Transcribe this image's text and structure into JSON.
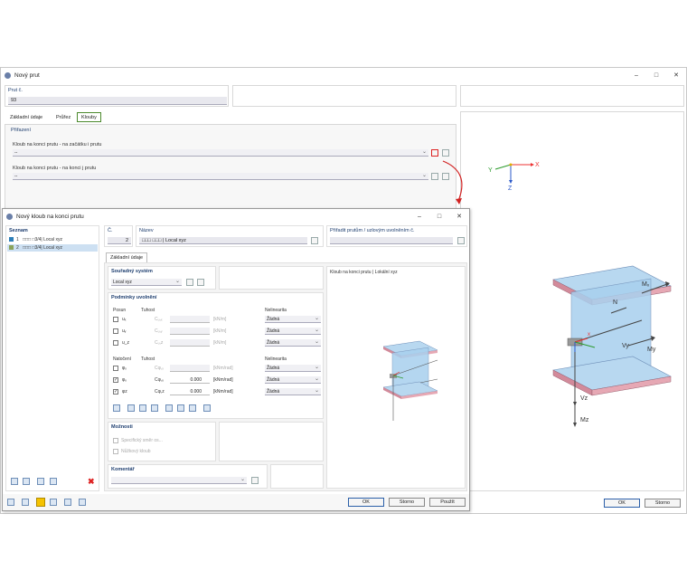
{
  "outer": {
    "title": "Nový prut",
    "prut_c_label": "Prut č.",
    "prut_c_value": "93",
    "tabs": [
      "Základní údaje",
      "Průřez",
      "Klouby"
    ],
    "prirazeni_label": "Přiřazení",
    "kloub_zacatek_label": "Kloub na konci prutu - na začátku i prutu",
    "kloub_zacatek_value": "--",
    "kloub_konec_label": "Kloub na konci prutu - na konci j prutu",
    "kloub_konec_value": "--",
    "ok": "OK",
    "storno": "Storno",
    "axis_x": "X",
    "axis_y": "Y",
    "axis_z": "Z",
    "fig": {
      "mx": "Mₓ",
      "n": "N",
      "vy": "Vy",
      "my": "My",
      "vz": "Vz",
      "mz": "Mz",
      "x": "x"
    }
  },
  "inner": {
    "title": "Nový kloub na konci prutu",
    "seznam_label": "Seznam",
    "list": [
      {
        "num": "1",
        "text": "□□□ □3/4| Local xyz",
        "color": "#2e7fb8"
      },
      {
        "num": "2",
        "text": "□□□ □3/4| Local xyz",
        "color": "#8aa35a"
      }
    ],
    "c_label": "Č.",
    "c_value": "2",
    "nazev_label": "Název",
    "nazev_value": "□□□ □□□ | Local xyz",
    "assign_label": "Přiřadit prutům / uzlovým uvolněním č.",
    "tab": "Základní údaje",
    "souradny_label": "Souřadný systém",
    "souradny_value": "Local xyz",
    "podminky_label": "Podmínky uvolnění",
    "posun_label": "Posun",
    "tuhost_label": "Tuhost",
    "nelinearita_label": "Nelinearita",
    "natoceni_label": "Natočení",
    "rows_posun": [
      {
        "sym": "uₓ",
        "c": "Cᵤ,ₓ",
        "val": "",
        "unit": "[kN/m]",
        "nl": "Žádná",
        "checked": false
      },
      {
        "sym": "uᵧ",
        "c": "Cᵤ,ᵧ",
        "val": "",
        "unit": "[kN/m]",
        "nl": "Žádná",
        "checked": false
      },
      {
        "sym": "u_z",
        "c": "Cᵤ,z",
        "val": "",
        "unit": "[kN/m]",
        "nl": "Žádná",
        "checked": false
      }
    ],
    "rows_natoceni": [
      {
        "sym": "φₓ",
        "c": "Cφ,ₓ",
        "val": "",
        "unit": "[kNm/rad]",
        "nl": "Žádná",
        "checked": false
      },
      {
        "sym": "φᵧ",
        "c": "Cφ,ᵧ",
        "val": "0.000",
        "unit": "[kNm/rad]",
        "nl": "Žádná",
        "checked": true
      },
      {
        "sym": "φz",
        "c": "Cφ,z",
        "val": "0.000",
        "unit": "[kNm/rad]",
        "nl": "Žádná",
        "checked": true
      }
    ],
    "moznosti_label": "Možnosti",
    "specificky": "Specifický směr os...",
    "noznicovy": "Nůžkový kloub",
    "komentar_label": "Komentář",
    "preview_label": "Kloub na konci prutu | Lokální xyz",
    "ok": "OK",
    "storno": "Storno",
    "pouzit": "Použít"
  },
  "colors": {
    "accent": "#2b5fa8",
    "tab_active_border": "#4c8a2d",
    "highlight_red": "#d22222",
    "beam_blue": "#9fc8ea",
    "beam_flange": "#d28a9a"
  }
}
